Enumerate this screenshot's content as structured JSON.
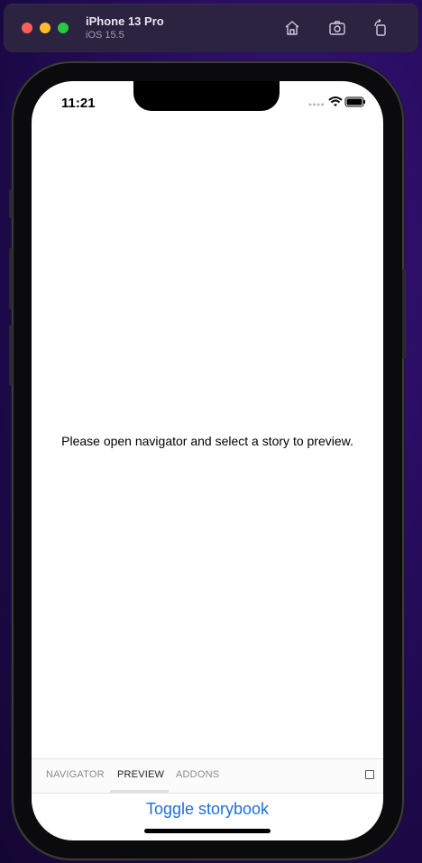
{
  "simulator": {
    "device_name": "iPhone 13 Pro",
    "os_version": "iOS 15.5",
    "toolbar_icons": [
      "home-icon",
      "screenshot-icon",
      "rotate-icon"
    ]
  },
  "status_bar": {
    "time": "11:21",
    "icons": [
      "signal-dots-icon",
      "wifi-icon",
      "battery-icon"
    ]
  },
  "preview": {
    "message": "Please open navigator and select a story to preview."
  },
  "tabs": [
    {
      "label": "NAVIGATOR",
      "active": false
    },
    {
      "label": "PREVIEW",
      "active": true
    },
    {
      "label": "ADDONS",
      "active": false
    }
  ],
  "toggle_button": "Toggle storybook",
  "colors": {
    "accent": "#1e6fd9",
    "background": "#2a0d63"
  }
}
